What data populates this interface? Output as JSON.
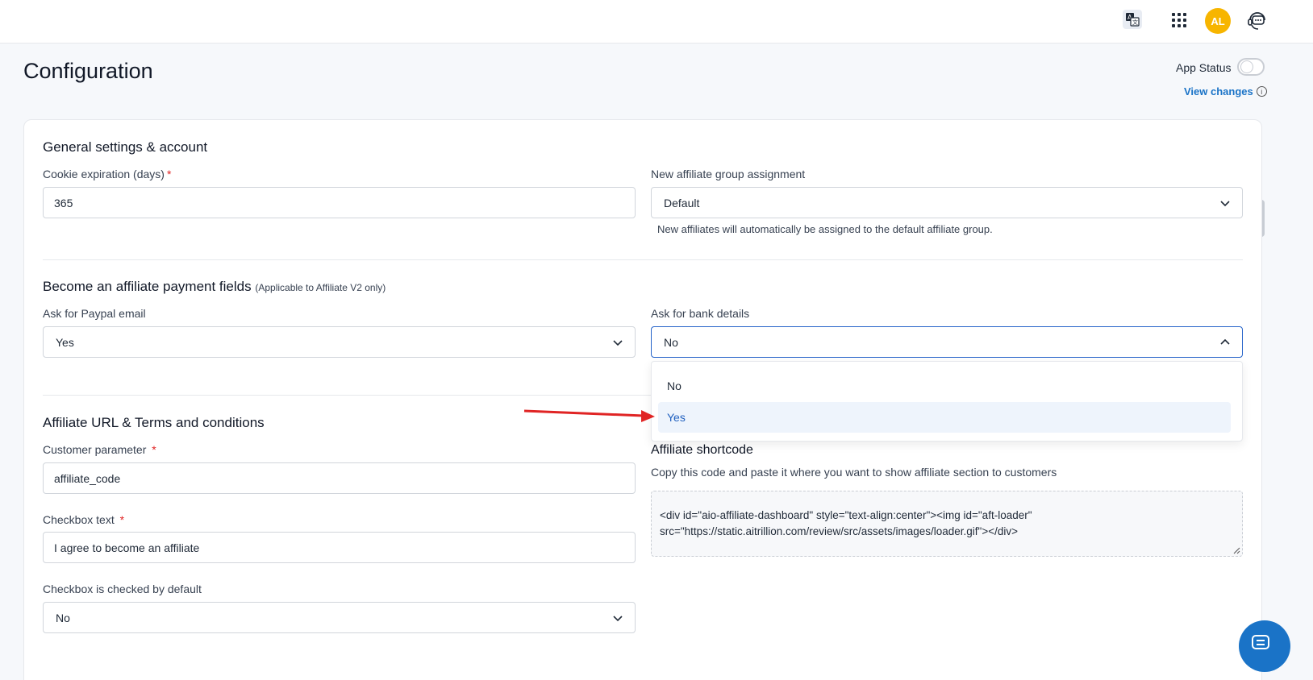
{
  "header": {
    "avatar_initials": "AL",
    "icons": [
      "translate-icon",
      "apps-grid-icon",
      "support-chat-icon"
    ]
  },
  "page": {
    "title": "Configuration",
    "app_status_label": "App Status",
    "app_status_on": false,
    "view_changes": "View changes"
  },
  "general": {
    "title": "General settings & account",
    "cookie_label": "Cookie expiration (days)",
    "cookie_required": "*",
    "cookie_value": "365",
    "group_label": "New affiliate group assignment",
    "group_value": "Default",
    "group_helper": "New affiliates will automatically be assigned to the default affiliate group."
  },
  "payment": {
    "title": "Become an affiliate payment fields",
    "subtitle": "(Applicable to Affiliate V2 only)",
    "paypal_label": "Ask for Paypal email",
    "paypal_value": "Yes",
    "bank_label": "Ask for bank details",
    "bank_value": "No",
    "bank_options": [
      "No",
      "Yes"
    ],
    "bank_highlighted": "Yes"
  },
  "affiliate": {
    "title": "Affiliate URL & Terms and conditions",
    "param_label": "Customer parameter",
    "param_required": "*",
    "param_value": "affiliate_code",
    "checkbox_text_label": "Checkbox text",
    "checkbox_text_required": "*",
    "checkbox_text_value": "I agree to become an affiliate",
    "checkbox_default_label": "Checkbox is checked by default",
    "checkbox_default_value": "No",
    "shortcode_title": "Affiliate shortcode",
    "shortcode_helper": "Copy this code and paste it where you want to show affiliate section to customers",
    "shortcode_code": "<div id=\"aio-affiliate-dashboard\" style=\"text-align:center\"><img id=\"aft-loader\" src=\"https://static.aitrillion.com/review/src/assets/images/loader.gif\"></div>"
  },
  "colors": {
    "accent": "#1a73c7",
    "avatar": "#f7b500",
    "annotation_arrow": "#e02424"
  }
}
